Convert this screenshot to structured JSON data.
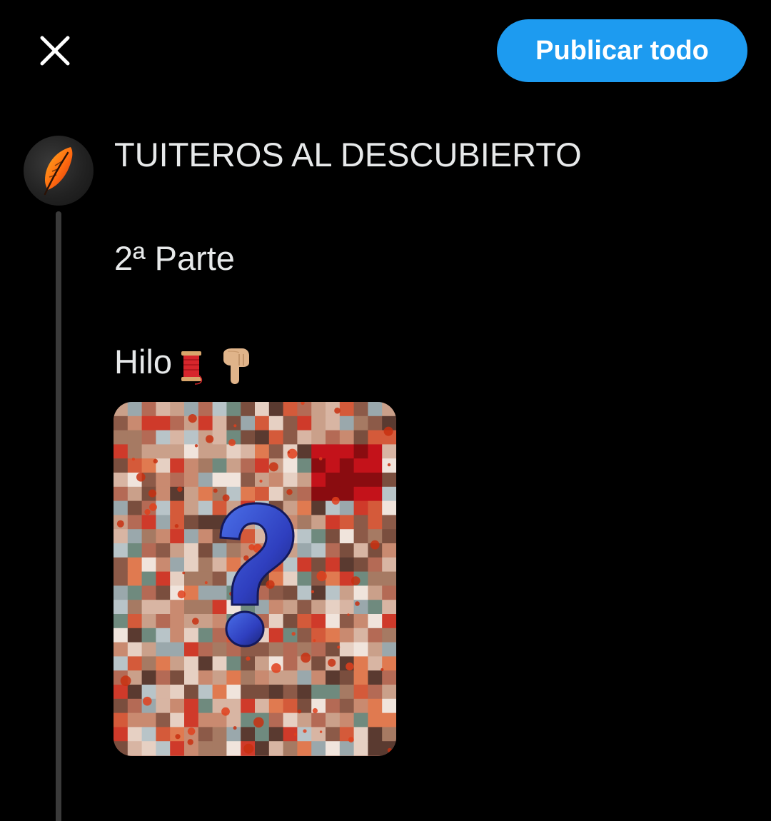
{
  "header": {
    "close_icon": "close-icon",
    "post_all_label": "Publicar todo",
    "accent_color": "#1d9bf0"
  },
  "composer": {
    "avatar_icon": "feather-quill-icon",
    "lines": [
      "TUITEROS AL DESCUBIERTO",
      "2ª Parte",
      "Hilo"
    ],
    "emojis": [
      "spool-of-thread-icon",
      "backhand-index-pointing-down-icon"
    ],
    "media": {
      "description_icon": "question-mark-icon"
    }
  },
  "colors": {
    "background": "#000000",
    "text": "#e7e9ea",
    "thread_line": "#3a3a3a"
  }
}
